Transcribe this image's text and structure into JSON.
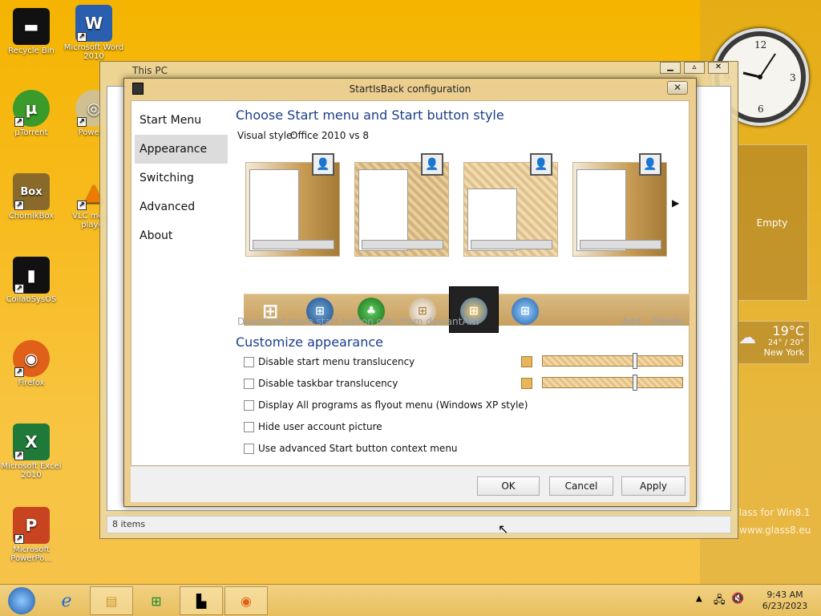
{
  "desktop": {
    "icons": [
      {
        "label": "Recycle Bin",
        "glyph": "▬"
      },
      {
        "label": "Microsoft Word 2010",
        "glyph": "W"
      },
      {
        "label": "µTorrent",
        "glyph": "µ"
      },
      {
        "label": "Power...",
        "glyph": "◎"
      },
      {
        "label": "ChomikBox",
        "glyph": "Box"
      },
      {
        "label": "VLC media player",
        "glyph": "▲"
      },
      {
        "label": "CollabSysOS",
        "glyph": "▮"
      },
      {
        "label": "Firefox",
        "glyph": "◉"
      },
      {
        "label": "Microsoft Excel 2010",
        "glyph": "X"
      },
      {
        "label": "Microsoft PowerPo...",
        "glyph": "P"
      }
    ]
  },
  "gadgets": {
    "empty_label": "Empty",
    "weather": {
      "temp": "19°C",
      "range": "24° / 20°",
      "city": "New York"
    },
    "watermark1": "glass for Win8.1",
    "watermark2": "www.glass8.eu"
  },
  "explorer": {
    "title": "This PC",
    "status": "8 items"
  },
  "dialog": {
    "title": "StartIsBack configuration",
    "close": "✕",
    "nav": [
      "Start Menu",
      "Appearance",
      "Switching",
      "Advanced",
      "About"
    ],
    "selected_nav": "Appearance",
    "heading1": "Choose Start menu and Start button style",
    "visual_style_label": "Visual style:",
    "visual_style_value": "Office 2010 vs 8",
    "download_link": "Download more start button orbs from deviantART",
    "add_link": "Add...",
    "delete_link": "Delete",
    "heading2": "Customize appearance",
    "options": [
      "Disable start menu translucency",
      "Disable taskbar translucency",
      "Display All programs as flyout menu (Windows XP style)",
      "Hide user account picture",
      "Use advanced Start button context menu"
    ],
    "buttons": {
      "ok": "OK",
      "cancel": "Cancel",
      "apply": "Apply"
    }
  },
  "taskbar": {
    "time": "9:43 AM",
    "date": "6/23/2023"
  }
}
